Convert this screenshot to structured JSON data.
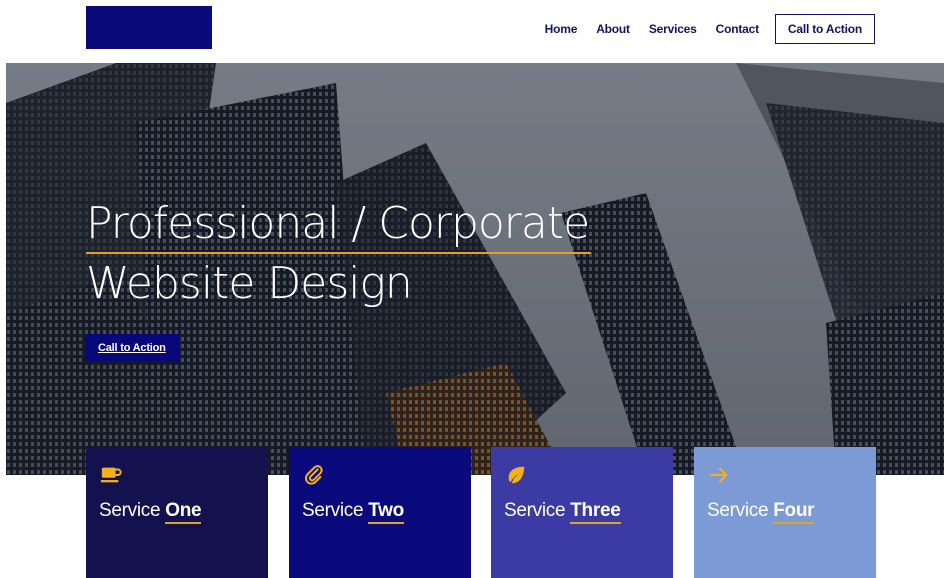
{
  "header": {
    "logo_alt": "",
    "nav": {
      "home": "Home",
      "about": "About",
      "services": "Services",
      "contact": "Contact",
      "cta": "Call to Action"
    }
  },
  "hero": {
    "title_line1": "Professional / Corporate",
    "title_line2": "Website Design",
    "cta": "Call to Action",
    "background": "city-skyscrapers-photo"
  },
  "services": [
    {
      "prefix": "Service",
      "emphasis": "One",
      "icon": "coffee-cup-icon",
      "color": "#14124e"
    },
    {
      "prefix": "Service",
      "emphasis": "Two",
      "icon": "paperclip-icon",
      "color": "#0b0a7c"
    },
    {
      "prefix": "Service",
      "emphasis": "Three",
      "icon": "leaf-icon",
      "color": "#3b3ba3"
    },
    {
      "prefix": "Service",
      "emphasis": "Four",
      "icon": "arrow-right-icon",
      "color": "#7b9ad6"
    }
  ],
  "colors": {
    "brand_navy": "#0a0a7a",
    "accent_gold": "#e0a321",
    "nav_text": "#121266"
  }
}
